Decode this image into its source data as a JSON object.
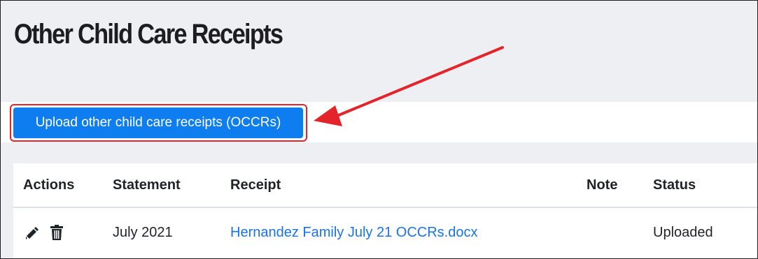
{
  "page": {
    "title": "Other Child Care Receipts"
  },
  "upload": {
    "button_label": "Upload other child care receipts (OCCRs)"
  },
  "table": {
    "headers": {
      "actions": "Actions",
      "statement": "Statement",
      "receipt": "Receipt",
      "note": "Note",
      "status": "Status"
    },
    "rows": [
      {
        "actions": [
          "pencil-icon",
          "trash-icon"
        ],
        "statement": "July 2021",
        "receipt": "Hernandez Family July 21 OCCRs.docx",
        "note": "",
        "status": "Uploaded"
      }
    ]
  },
  "colors": {
    "button": "#0d7df0",
    "highlight": "#e3242b",
    "link": "#1a73e8",
    "background": "#eeeff3"
  }
}
